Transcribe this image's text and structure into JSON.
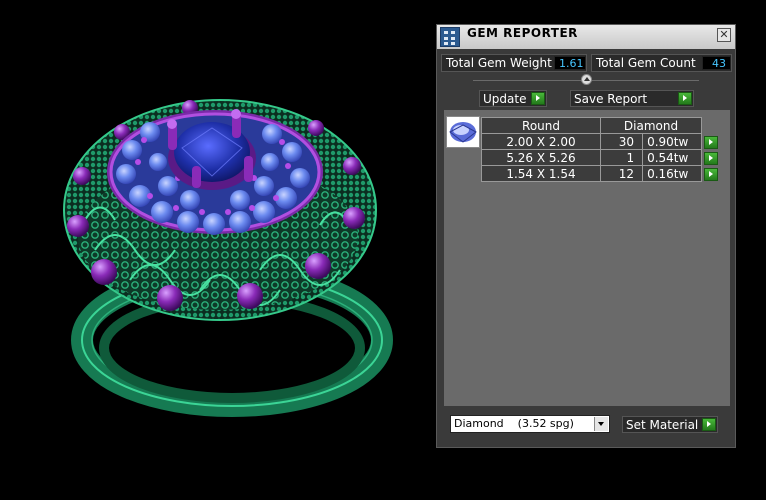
{
  "panel": {
    "title": "GEM REPORTER",
    "close_icon": "x-icon",
    "app_icon": "gem-reporter-app-icon"
  },
  "stats": {
    "total_weight_label": "Total Gem Weight",
    "total_weight_value": "1.61",
    "total_count_label": "Total Gem Count",
    "total_count_value": "43"
  },
  "toolbar": {
    "update_label": "Update",
    "save_report_label": "Save Report"
  },
  "gem_table": {
    "header": {
      "shape": "Round",
      "material": "Diamond"
    },
    "rows": [
      {
        "size": "2.00 X 2.00",
        "count": "30",
        "weight": "0.90tw"
      },
      {
        "size": "5.26 X 5.26",
        "count": "1",
        "weight": "0.54tw"
      },
      {
        "size": "1.54 X 1.54",
        "count": "12",
        "weight": "0.16tw"
      }
    ]
  },
  "material": {
    "selected": "Diamond    (3.52 spg)",
    "set_material_label": "Set Material"
  },
  "colors": {
    "metal": "#1f9a6a",
    "stone_blue": "#6d8cf0",
    "center_stone": "#1e2fa8",
    "amethyst": "#8a2bb8",
    "accent_value": "#46c6ff",
    "go_button": "#3aa52c"
  }
}
